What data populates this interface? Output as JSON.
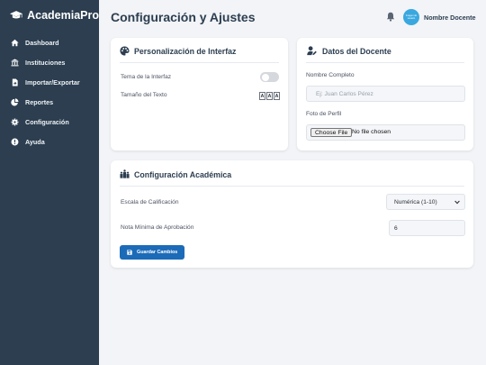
{
  "app": {
    "brand": "AcademiaPro"
  },
  "sidebar": {
    "items": [
      {
        "label": "Dashboard",
        "icon": "home-icon"
      },
      {
        "label": "Instituciones",
        "icon": "institution-icon"
      },
      {
        "label": "Importar/Exportar",
        "icon": "file-import-icon"
      },
      {
        "label": "Reportes",
        "icon": "chart-pie-icon"
      },
      {
        "label": "Configuración",
        "icon": "gear-icon"
      },
      {
        "label": "Ayuda",
        "icon": "help-icon"
      }
    ]
  },
  "header": {
    "title": "Configuración y Ajustes",
    "user_name": "Nombre Docente",
    "avatar_line1": "Imagen de",
    "avatar_line2": "usuario"
  },
  "interface_card": {
    "title": "Personalización de Interfaz",
    "theme_label": "Tema de la Interfaz",
    "theme_dark_enabled": false,
    "text_size_label": "Tamaño del Texto",
    "text_size_buttons": [
      "A",
      "A",
      "A"
    ]
  },
  "teacher_card": {
    "title": "Datos del Docente",
    "name_label": "Nombre Completo",
    "name_placeholder": "Ej: Juan Carlos Pérez",
    "photo_label": "Foto de Perfil",
    "file_button": "Choose File",
    "file_status": "No file chosen"
  },
  "academic_card": {
    "title": "Configuración Académica",
    "scale_label": "Escala de Calificación",
    "scale_selected": "Numérica (1-10)",
    "min_grade_label": "Nota Mínima de Aprobación",
    "min_grade_value": "6",
    "save_label": "Guardar Cambios"
  },
  "colors": {
    "sidebar": "#2c3e50",
    "accent": "#1c6bb8",
    "avatar": "#3aa8df",
    "background": "#f2f4f7"
  }
}
